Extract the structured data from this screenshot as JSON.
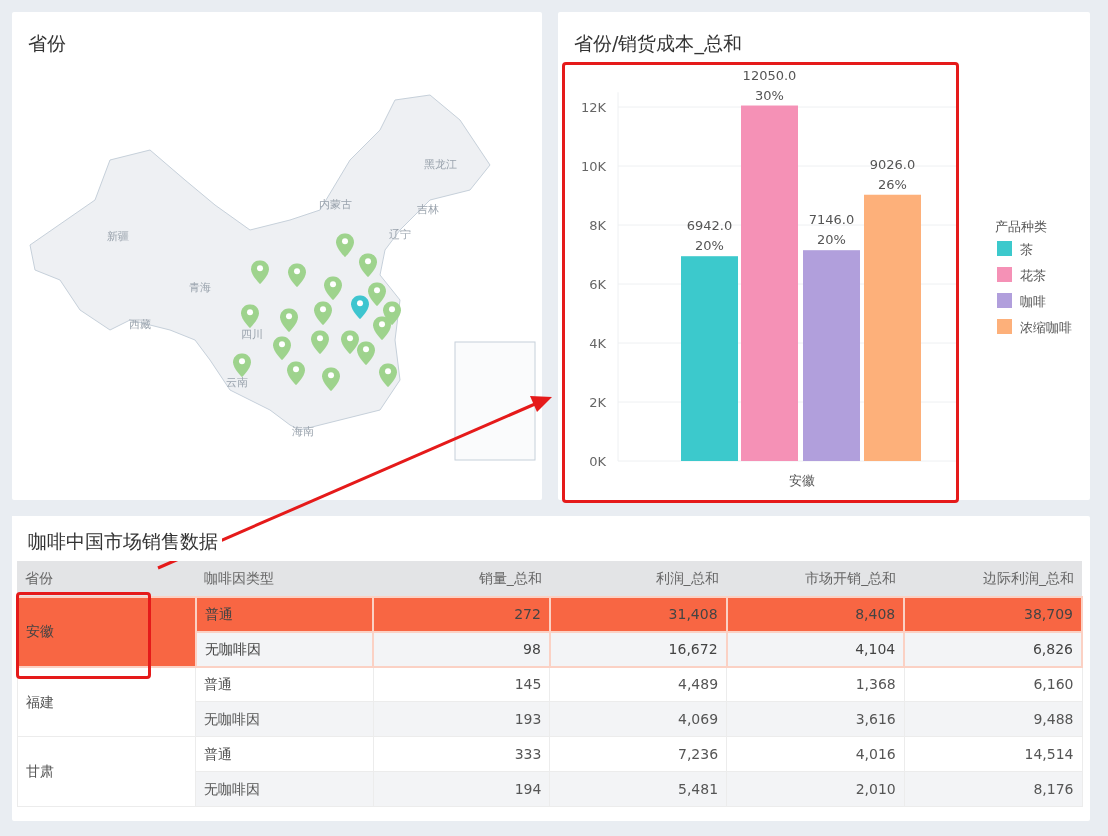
{
  "map_panel": {
    "title": "省份",
    "region_labels": [
      "新疆",
      "青海",
      "西藏",
      "内蒙古",
      "黑龙江",
      "吉林",
      "辽宁",
      "四川",
      "云南",
      "海南"
    ],
    "pins": [
      {
        "selected": false
      },
      {
        "selected": false
      },
      {
        "selected": false
      },
      {
        "selected": false
      },
      {
        "selected": false
      },
      {
        "selected": false
      },
      {
        "selected": true
      },
      {
        "selected": false
      },
      {
        "selected": false
      },
      {
        "selected": false
      },
      {
        "selected": false
      },
      {
        "selected": false
      },
      {
        "selected": false
      },
      {
        "selected": false
      },
      {
        "selected": false
      },
      {
        "selected": false
      },
      {
        "selected": false
      },
      {
        "selected": false
      },
      {
        "selected": false
      },
      {
        "selected": false
      }
    ]
  },
  "chart_panel": {
    "title": "省份/销货成本_总和",
    "legend_title": "产品种类",
    "chart_data": {
      "type": "bar",
      "categories": [
        "安徽"
      ],
      "yticks": [
        {
          "value": 0,
          "label": "0K"
        },
        {
          "value": 2000,
          "label": "2K"
        },
        {
          "value": 4000,
          "label": "4K"
        },
        {
          "value": 6000,
          "label": "6K"
        },
        {
          "value": 8000,
          "label": "8K"
        },
        {
          "value": 10000,
          "label": "10K"
        },
        {
          "value": 12000,
          "label": "12K"
        }
      ],
      "ylim": [
        0,
        12500
      ],
      "grid": true,
      "legend": true,
      "series": [
        {
          "name": "茶",
          "color": "#3cc9cc",
          "values": [
            6942
          ]
        },
        {
          "name": "花茶",
          "color": "#f591b6",
          "values": [
            12050
          ]
        },
        {
          "name": "咖啡",
          "color": "#b19fdc",
          "values": [
            7146
          ]
        },
        {
          "name": "浓缩咖啡",
          "color": "#fdb07a",
          "values": [
            9026
          ]
        }
      ],
      "value_labels": [
        [
          "6942.0",
          "20%"
        ],
        [
          "12050.0",
          "30%"
        ],
        [
          "7146.0",
          "20%"
        ],
        [
          "9026.0",
          "26%"
        ]
      ]
    }
  },
  "table_panel": {
    "title": "咖啡中国市场销售数据",
    "columns": [
      "省份",
      "咖啡因类型",
      "销量_总和",
      "利润_总和",
      "市场开销_总和",
      "边际利润_总和"
    ],
    "groups": [
      {
        "province": "安徽",
        "highlighted": true,
        "rows": [
          {
            "type": "普通",
            "values": [
              "272",
              "31,408",
              "8,408",
              "38,709"
            ]
          },
          {
            "type": "无咖啡因",
            "values": [
              "98",
              "16,672",
              "4,104",
              "6,826"
            ]
          }
        ]
      },
      {
        "province": "福建",
        "highlighted": false,
        "rows": [
          {
            "type": "普通",
            "values": [
              "145",
              "4,489",
              "1,368",
              "6,160"
            ]
          },
          {
            "type": "无咖啡因",
            "values": [
              "193",
              "4,069",
              "3,616",
              "9,488"
            ]
          }
        ]
      },
      {
        "province": "甘肃",
        "highlighted": false,
        "rows": [
          {
            "type": "普通",
            "values": [
              "333",
              "7,236",
              "4,016",
              "14,514"
            ]
          },
          {
            "type": "无咖啡因",
            "values": [
              "194",
              "5,481",
              "2,010",
              "8,176"
            ]
          }
        ]
      }
    ]
  }
}
